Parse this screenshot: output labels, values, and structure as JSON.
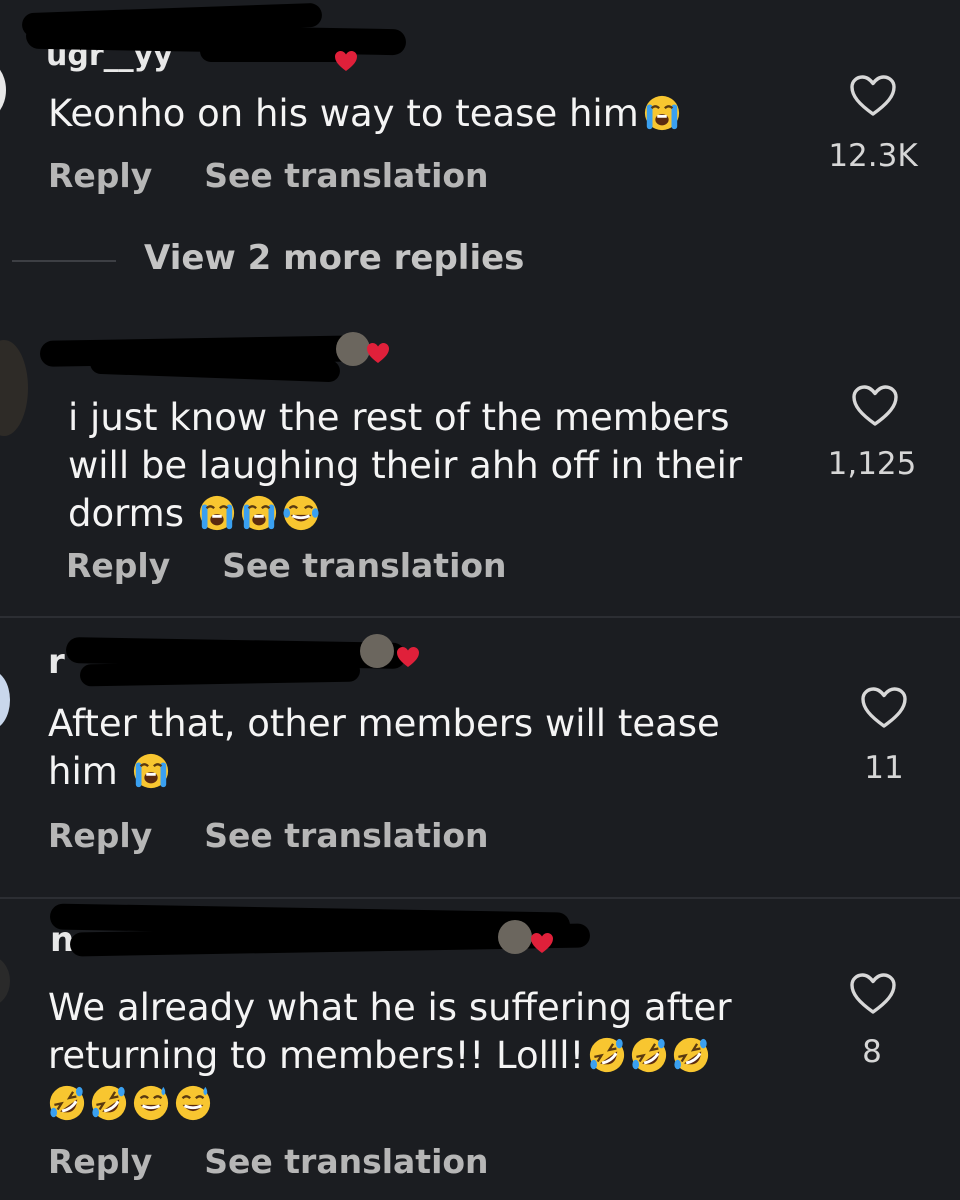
{
  "comments": [
    {
      "text_lines": [
        "Keonho on his way to tease him"
      ],
      "emojis": [
        "loudly-crying"
      ],
      "reply_label": "Reply",
      "translate_label": "See translation",
      "like_count": "12.3K"
    },
    {
      "text_lines": [
        "i just know the rest of the members",
        "will be laughing their ahh off in their",
        "dorms"
      ],
      "emojis": [
        "loudly-crying",
        "loudly-crying",
        "tears-of-joy"
      ],
      "reply_label": "Reply",
      "translate_label": "See translation",
      "like_count": "1,125"
    },
    {
      "text_lines": [
        "After that, other members will tease",
        "him"
      ],
      "emojis": [
        "loudly-crying"
      ],
      "reply_label": "Reply",
      "translate_label": "See translation",
      "like_count": "11"
    },
    {
      "text_lines": [
        "We already what he is suffering after",
        "returning to members!! Lolll!"
      ],
      "emojis": [
        "rolling-on-floor-laughing",
        "rolling-on-floor-laughing",
        "rolling-on-floor-laughing",
        "rolling-on-floor-laughing",
        "rolling-on-floor-laughing",
        "grinning-sweat",
        "grinning-sweat"
      ],
      "reply_label": "Reply",
      "translate_label": "See translation",
      "like_count": "8"
    }
  ],
  "view_more_replies": "View 2 more replies",
  "icons": {
    "like": "heart-outline-icon",
    "username_badge": "red-heart-icon"
  },
  "colors": {
    "background": "#1b1d21",
    "text": "#f4f4f4",
    "secondary": "#b6b6b6",
    "redaction": "#000000",
    "heart_badge": "#e0203a"
  }
}
